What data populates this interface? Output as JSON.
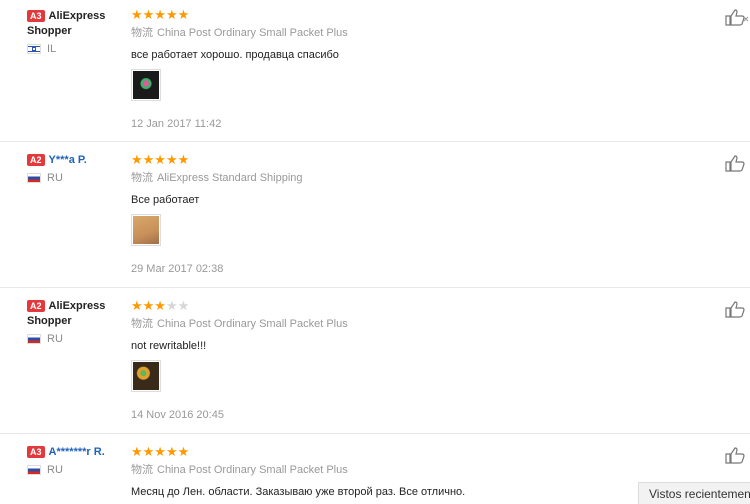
{
  "reviews": [
    {
      "level": "A3",
      "name": "AliExpress Shopper",
      "country": "IL",
      "rating": 5,
      "shipping_prefix": "物流",
      "shipping": "China Post Ordinary Small Packet Plus",
      "text": "все работает хорошо. продавца спасибо",
      "date": "12 Jan 2017 11:42"
    },
    {
      "level": "A2",
      "name": "Y***a P.",
      "country": "RU",
      "rating": 5,
      "shipping_prefix": "物流",
      "shipping": "AliExpress Standard Shipping",
      "text": "Все работает",
      "date": "29 Mar 2017 02:38"
    },
    {
      "level": "A2",
      "name": "AliExpress Shopper",
      "country": "RU",
      "rating": 3,
      "shipping_prefix": "物流",
      "shipping": "China Post Ordinary Small Packet Plus",
      "text": "not rewritable!!!",
      "date": "14 Nov 2016 20:45"
    },
    {
      "level": "A3",
      "name": "A*******r R.",
      "country": "RU",
      "rating": 5,
      "shipping_prefix": "物流",
      "shipping": "China Post Ordinary Small Packet Plus",
      "text": "Месяц до Лен. области. Заказываю уже второй раз. Все отлично.",
      "date": ""
    }
  ],
  "recent_label": "Vistos recientemente"
}
